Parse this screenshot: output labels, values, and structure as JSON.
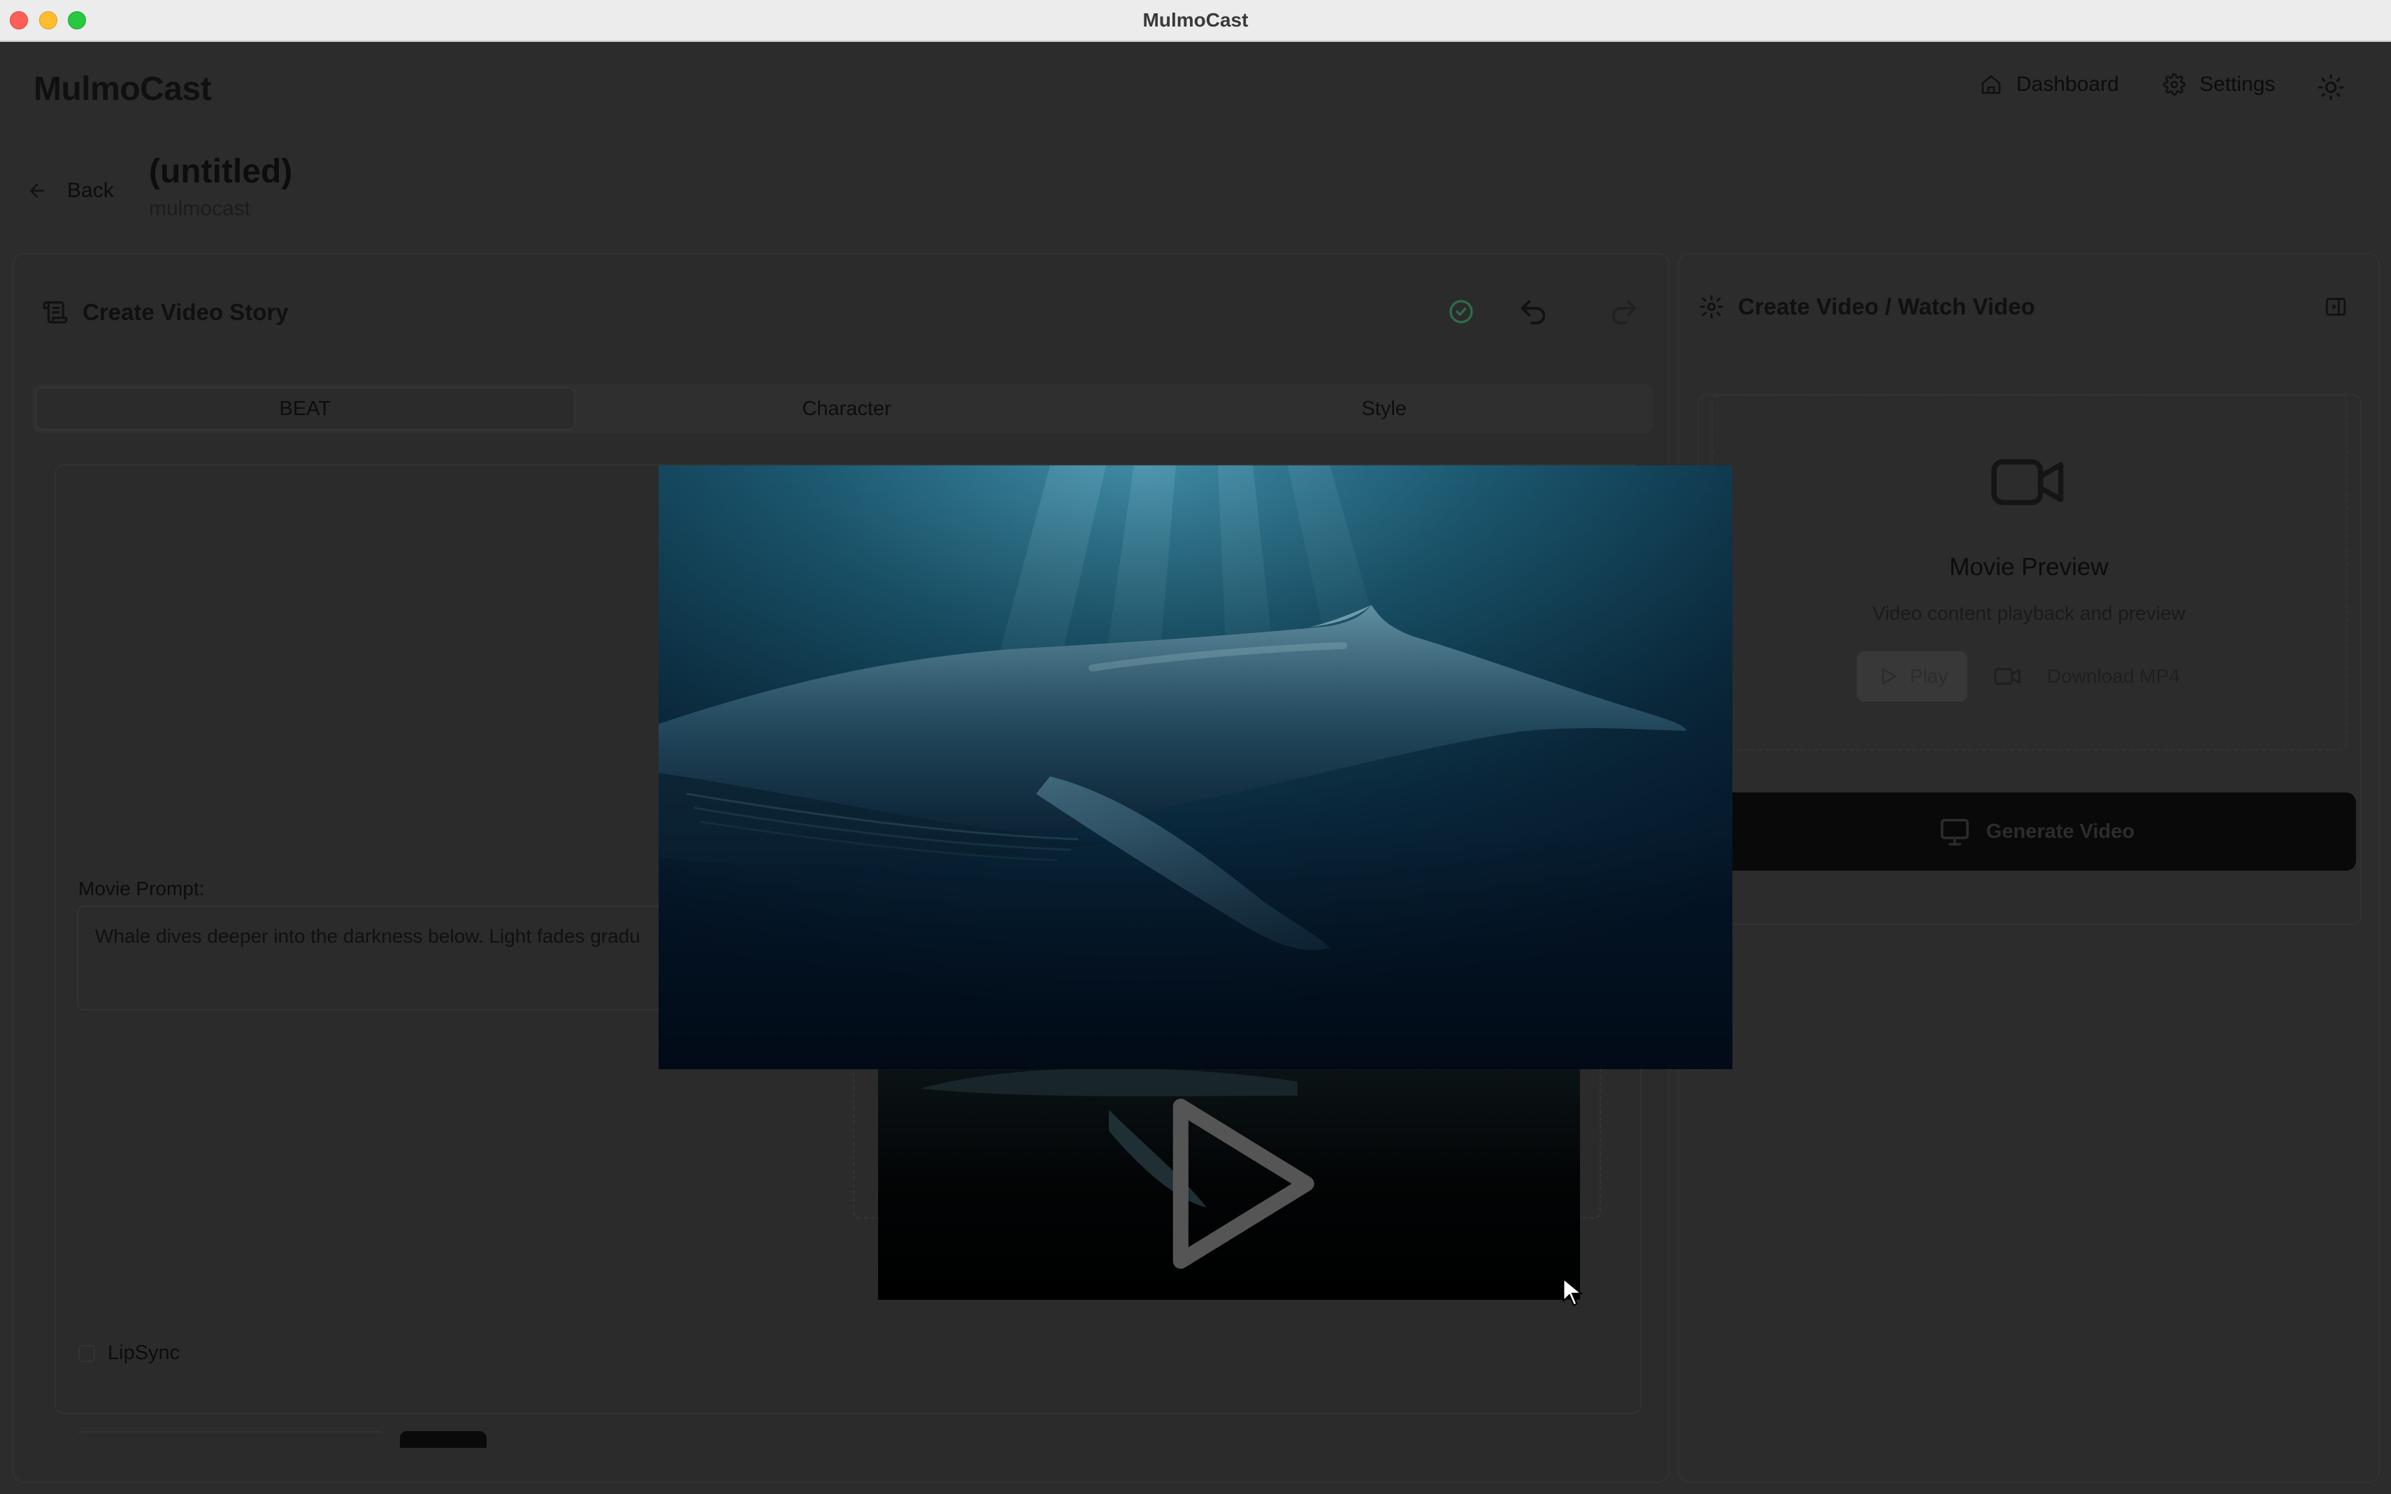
{
  "window": {
    "title": "MulmoCast"
  },
  "header": {
    "logo": "MulmoCast",
    "nav": {
      "dashboard_label": "Dashboard",
      "settings_label": "Settings"
    }
  },
  "project": {
    "back_label": "Back",
    "title": "(untitled)",
    "subtitle": "mulmocast"
  },
  "editor": {
    "title": "Create Video Story",
    "tabs": [
      {
        "label": "BEAT",
        "active": true
      },
      {
        "label": "Character",
        "active": false
      },
      {
        "label": "Style",
        "active": false
      }
    ],
    "movie_prompt_label": "Movie Prompt:",
    "movie_prompt_value": "Whale dives deeper into the darkness below. Light fades gradu",
    "lipsync_label": "LipSync"
  },
  "preview_panel": {
    "title": "Create Video / Watch Video",
    "movie_preview_title": "Movie Preview",
    "movie_preview_subtitle": "Video content playback and preview",
    "play_label": "Play",
    "download_label": "Download MP4",
    "generate_label": "Generate Video"
  },
  "colors": {
    "titlebar": "#ececec",
    "background": "#2c2c2c",
    "primary_button": "#090909",
    "check_accent": "#2e6b4a"
  },
  "icons": [
    "home-icon",
    "gear-icon",
    "sun-icon",
    "arrow-left-icon",
    "scroll-icon",
    "check-circle-icon",
    "undo-icon",
    "redo-icon",
    "video-camera-icon",
    "play-icon",
    "monitor-icon",
    "panel-collapse-icon"
  ]
}
